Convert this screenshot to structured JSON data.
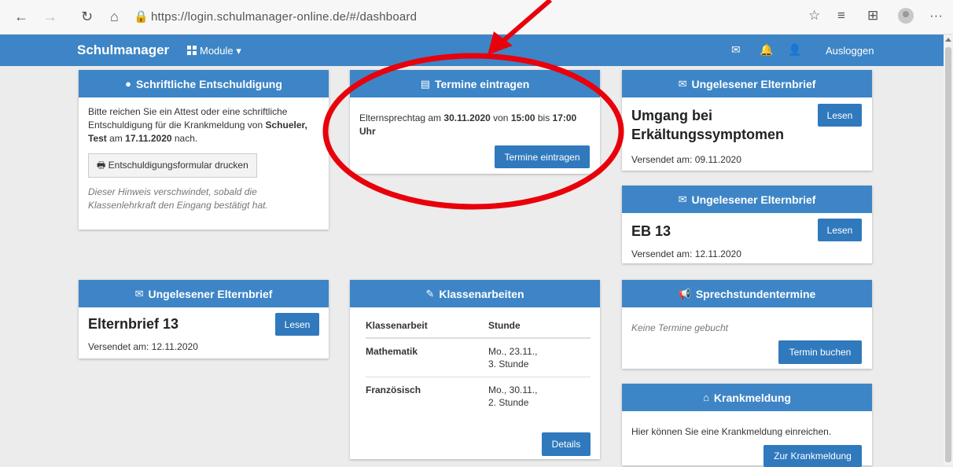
{
  "browser": {
    "url": "https://login.schulmanager-online.de/#/dashboard",
    "back": "←",
    "forward": "→",
    "reload": "↻",
    "home": "⌂",
    "lock": "🔒",
    "fav": "☆",
    "favs": "≡",
    "collections": "⊞",
    "more": "···"
  },
  "navbar": {
    "brand": "Schulmanager",
    "modules": "Module ▾",
    "mail_icon": "✉",
    "bell_icon": "🔔",
    "user_icon": "👤",
    "logout": "Ausloggen",
    "color": "#3d85c6"
  },
  "cards": {
    "entschuldigung": {
      "title": "Schriftliche Entschuldigung",
      "text_a": "Bitte reichen Sie ein Attest oder eine schriftliche Entschuldigung für die Krankmeldung von ",
      "text_b": "Schueler, Test",
      "text_c": " am ",
      "text_d": "17.11.2020",
      "text_e": " nach.",
      "button": "Entschuldigungsformular drucken",
      "hint": "Dieser Hinweis verschwindet, sobald die Klassenlehrkraft den Eingang bestätigt hat."
    },
    "termine": {
      "title": "Termine eintragen",
      "t1": "Elternsprechtag am ",
      "t2": "30.11.2020",
      "t3": " von ",
      "t4": "15:00",
      "t5": " bis ",
      "t6": "17:00 Uhr",
      "button": "Termine eintragen"
    },
    "brief1": {
      "title": "Ungelesener Elternbrief",
      "subject": "Umgang bei Erkältungssymptomen",
      "button": "Lesen",
      "sent": "Versendet am: 09.11.2020"
    },
    "brief2": {
      "title": "Ungelesener Elternbrief",
      "subject": "EB 13",
      "button": "Lesen",
      "sent": "Versendet am: 12.11.2020"
    },
    "brief3": {
      "title": "Ungelesener Elternbrief",
      "subject": "Elternbrief 13",
      "button": "Lesen",
      "sent": "Versendet am: 12.11.2020"
    },
    "klassenarbeiten": {
      "title": "Klassenarbeiten",
      "col1": "Klassenarbeit",
      "col2": "Stunde",
      "rows": [
        {
          "subject": "Mathematik",
          "when1": "Mo., 23.11.,",
          "when2": "3. Stunde"
        },
        {
          "subject": "Französisch",
          "when1": "Mo., 30.11.,",
          "when2": "2. Stunde"
        }
      ],
      "button": "Details"
    },
    "sprechstunden": {
      "title": "Sprechstundentermine",
      "empty": "Keine Termine gebucht",
      "button": "Termin buchen"
    },
    "krank": {
      "title": "Krankmeldung",
      "text": "Hier können Sie eine Krankmeldung einreichen.",
      "button": "Zur Krankmeldung"
    }
  },
  "icons": {
    "info": "●",
    "calendar": "▤",
    "mail": "✉",
    "edit": "✎",
    "megaphone": "📢",
    "home": "⌂",
    "print": "🖶"
  },
  "annotation": {
    "color": "#e8000b"
  }
}
